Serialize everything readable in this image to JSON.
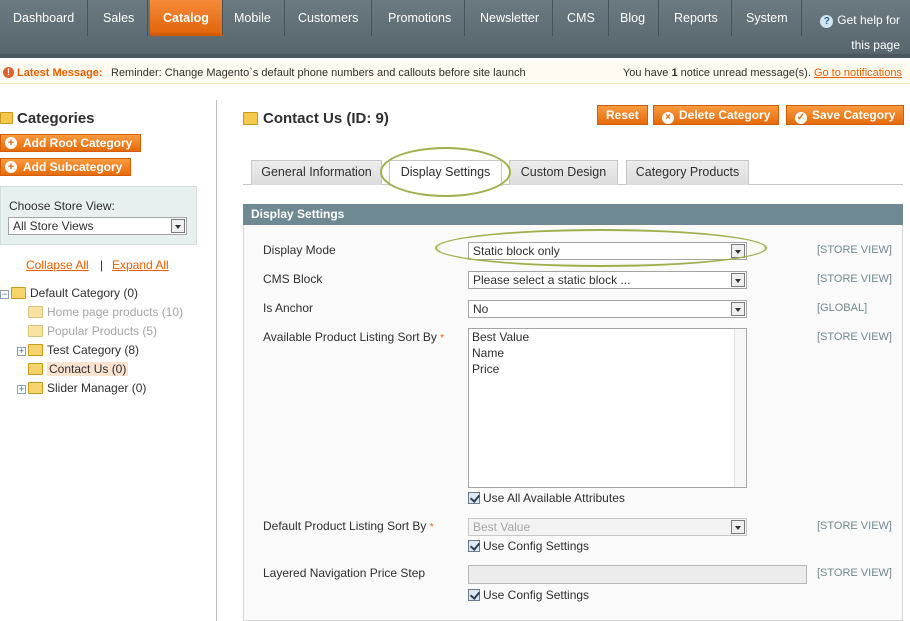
{
  "nav": {
    "items": [
      "Dashboard",
      "Sales",
      "Catalog",
      "Mobile",
      "Customers",
      "Promotions",
      "Newsletter",
      "CMS",
      "Blog",
      "Reports",
      "System"
    ],
    "active": "Catalog",
    "help_line1": "Get help for",
    "help_line2": "this page"
  },
  "message": {
    "label": "Latest Message:",
    "text": "Reminder: Change Magento`s default phone numbers and callouts before site launch",
    "notice_prefix": "You have",
    "notice_count": "1",
    "notice_suffix": "notice unread message(s).",
    "link": "Go to notifications"
  },
  "sidebar": {
    "title": "Categories",
    "add_root": "Add Root Category",
    "add_sub": "Add Subcategory",
    "store_view_label": "Choose Store View:",
    "store_view_value": "All Store Views",
    "collapse_all": "Collapse All",
    "separator": "|",
    "expand_all": "Expand All",
    "tree": [
      {
        "label": "Default Category (0)"
      },
      {
        "label": "Home page products (10)"
      },
      {
        "label": "Popular Products (5)"
      },
      {
        "label": "Test Category (8)"
      },
      {
        "label": "Contact Us (0)"
      },
      {
        "label": "Slider Manager (0)"
      }
    ]
  },
  "main": {
    "title": "Contact Us (ID: 9)",
    "reset": "Reset",
    "delete": "Delete Category",
    "save": "Save Category",
    "tabs": [
      "General Information",
      "Display Settings",
      "Custom Design",
      "Category Products"
    ],
    "section_title": "Display Settings",
    "fields": {
      "display_mode": {
        "label": "Display Mode",
        "value": "Static block only",
        "scope": "[STORE VIEW]"
      },
      "cms_block": {
        "label": "CMS Block",
        "value": "Please select a static block ...",
        "scope": "[STORE VIEW]"
      },
      "is_anchor": {
        "label": "Is Anchor",
        "value": "No",
        "scope": "[GLOBAL]"
      },
      "sort_by": {
        "label": "Available Product Listing Sort By",
        "req": "*",
        "options": [
          "Best Value",
          "Name",
          "Price"
        ],
        "scope": "[STORE VIEW]",
        "check": "Use All Available Attributes"
      },
      "default_sort": {
        "label": "Default Product Listing Sort By",
        "req": "*",
        "value": "Best Value",
        "scope": "[STORE VIEW]",
        "check": "Use Config Settings"
      },
      "price_step": {
        "label": "Layered Navigation Price Step",
        "scope": "[STORE VIEW]",
        "check": "Use Config Settings"
      }
    }
  }
}
